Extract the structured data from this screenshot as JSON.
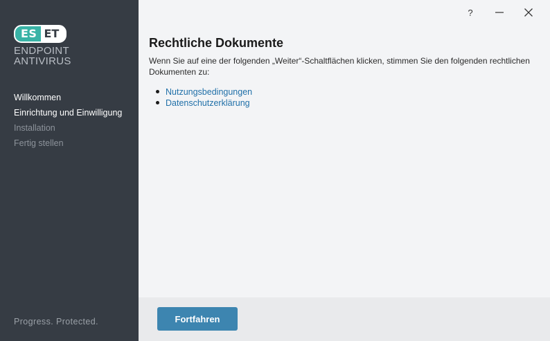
{
  "brand": {
    "logo_left": "ES",
    "logo_right": "ET",
    "product_line1": "ENDPOINT",
    "product_line2": "ANTIVIRUS",
    "tagline": "Progress. Protected.",
    "accent_color": "#39b3a6"
  },
  "sidebar": {
    "steps": [
      {
        "label": "Willkommen",
        "state": "done"
      },
      {
        "label": "Einrichtung und Einwilligung",
        "state": "current"
      },
      {
        "label": "Installation",
        "state": "pending"
      },
      {
        "label": "Fertig stellen",
        "state": "pending"
      }
    ]
  },
  "titlebar": {
    "help_label": "?",
    "minimize_label": "—",
    "close_label": "✕"
  },
  "main": {
    "title": "Rechtliche Dokumente",
    "description": "Wenn Sie auf eine der folgenden „Weiter“-Schaltflächen klicken, stimmen Sie den folgenden rechtlichen Dokumenten zu:",
    "links": [
      {
        "label": "Nutzungsbedingungen"
      },
      {
        "label": "Datenschutzerklärung"
      }
    ]
  },
  "footer": {
    "continue_label": "Fortfahren",
    "button_color": "#3d85b0"
  }
}
